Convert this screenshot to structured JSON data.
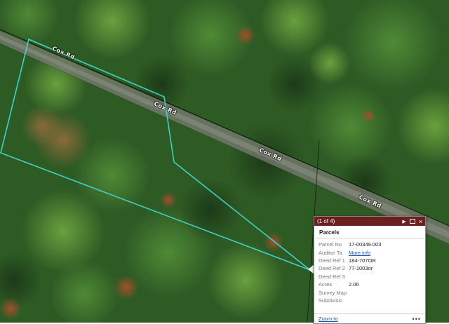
{
  "map": {
    "road_name": "Cox Rd",
    "parcel_outline_color": "#3fd1c6",
    "road_line_color": "#000000"
  },
  "popup": {
    "counter": "(1 of 4)",
    "next_icon": "next-triangle-icon",
    "maximize_icon": "maximize-icon",
    "close_icon": "close-icon",
    "title": "Parcels",
    "fields": [
      {
        "label": "Parcel No",
        "value": "17-00349.003"
      },
      {
        "label": "Auditor Ta",
        "value": "More info",
        "link": true
      },
      {
        "label": "Deed Ref 1",
        "value": "184-707OR"
      },
      {
        "label": "Deed Ref 2",
        "value": "77-1003or"
      },
      {
        "label": "Deed Ref 3",
        "value": ""
      },
      {
        "label": "Acres",
        "value": "2.06"
      },
      {
        "label": "Survey Map",
        "value": ""
      },
      {
        "label": "Subdivisio",
        "value": ""
      }
    ],
    "zoom_label": "Zoom to",
    "more_label": "•••",
    "header_color": "#6b1f1f",
    "link_color": "#1a55a6"
  }
}
